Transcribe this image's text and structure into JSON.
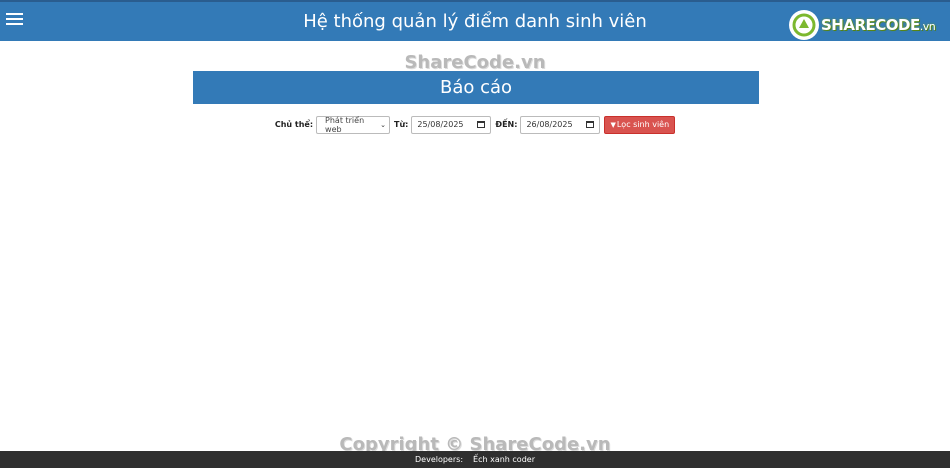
{
  "header": {
    "title": "Hệ thống quản lý điểm danh sinh viên",
    "logo_main": "SHARECODE",
    "logo_suffix": ".vn",
    "bar_color": "#337ab7"
  },
  "watermark": {
    "top": "ShareCode.vn",
    "bottom": "Copyright © ShareCode.vn"
  },
  "report": {
    "title": "Báo cáo"
  },
  "filters": {
    "subject_label": "Chủ thể:",
    "subject_value": "Phát triển web",
    "from_label": "Từ:",
    "from_value": "25/08/2025",
    "to_label": "ĐẾN:",
    "to_value": "26/08/2025",
    "button_label": "Lọc sinh viên",
    "button_color": "#d9534f"
  },
  "footer": {
    "developers_label": "Developers:",
    "developers_value": "Ếch xanh coder"
  }
}
